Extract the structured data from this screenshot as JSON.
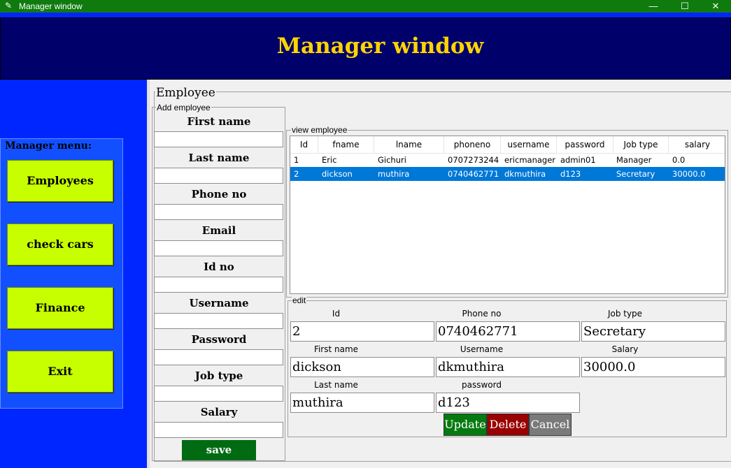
{
  "window": {
    "title": "Manager window",
    "minimize": "—",
    "maximize": "☐",
    "close": "✕"
  },
  "banner": {
    "title": "Manager window"
  },
  "menu": {
    "legend": "Manager menu:",
    "items": [
      "Employees",
      "check cars",
      "Finance",
      "Exit"
    ]
  },
  "employee": {
    "legend": "Employee",
    "add": {
      "legend": "Add employee",
      "fields": [
        "First name",
        "Last name",
        "Phone no",
        "Email",
        "Id no",
        "Username",
        "Password",
        "Job type",
        "Salary"
      ],
      "save_label": "save"
    },
    "view": {
      "legend": "view employee",
      "columns": [
        "Id",
        "fname",
        "lname",
        "phoneno",
        "username",
        "password",
        "Job type",
        "salary"
      ],
      "rows": [
        [
          "1",
          "Eric",
          "Gichuri",
          "0707273244",
          "ericmanager",
          "admin01",
          "Manager",
          "0.0"
        ],
        [
          "2",
          "dickson",
          "muthira",
          "0740462771",
          "dkmuthira",
          "d123",
          "Secretary",
          "30000.0"
        ]
      ],
      "selected_row": 1
    },
    "edit": {
      "legend": "edit",
      "labels": {
        "id": "Id",
        "phone": "Phone no",
        "job": "Job type",
        "fname": "First name",
        "username": "Username",
        "salary": "Salary",
        "lname": "Last name",
        "password": "password"
      },
      "values": {
        "id": "2",
        "phone": "0740462771",
        "job": "Secretary",
        "fname": "dickson",
        "username": "dkmuthira",
        "salary": "30000.0",
        "lname": "muthira",
        "password": "d123"
      },
      "buttons": {
        "update": "Update",
        "delete": "Delete",
        "cancel": "Cancel"
      }
    }
  },
  "colors": {
    "titlebar": "#0f7b0f",
    "banner_bg": "#00006b",
    "banner_text": "#ffd400",
    "menu_button": "#c8ff00",
    "save_button": "#006b12",
    "update_button": "#067a10",
    "delete_button": "#990000",
    "cancel_button": "#7a7a7a",
    "selection": "#0078d7"
  },
  "icons": {
    "app": "feather-icon"
  }
}
